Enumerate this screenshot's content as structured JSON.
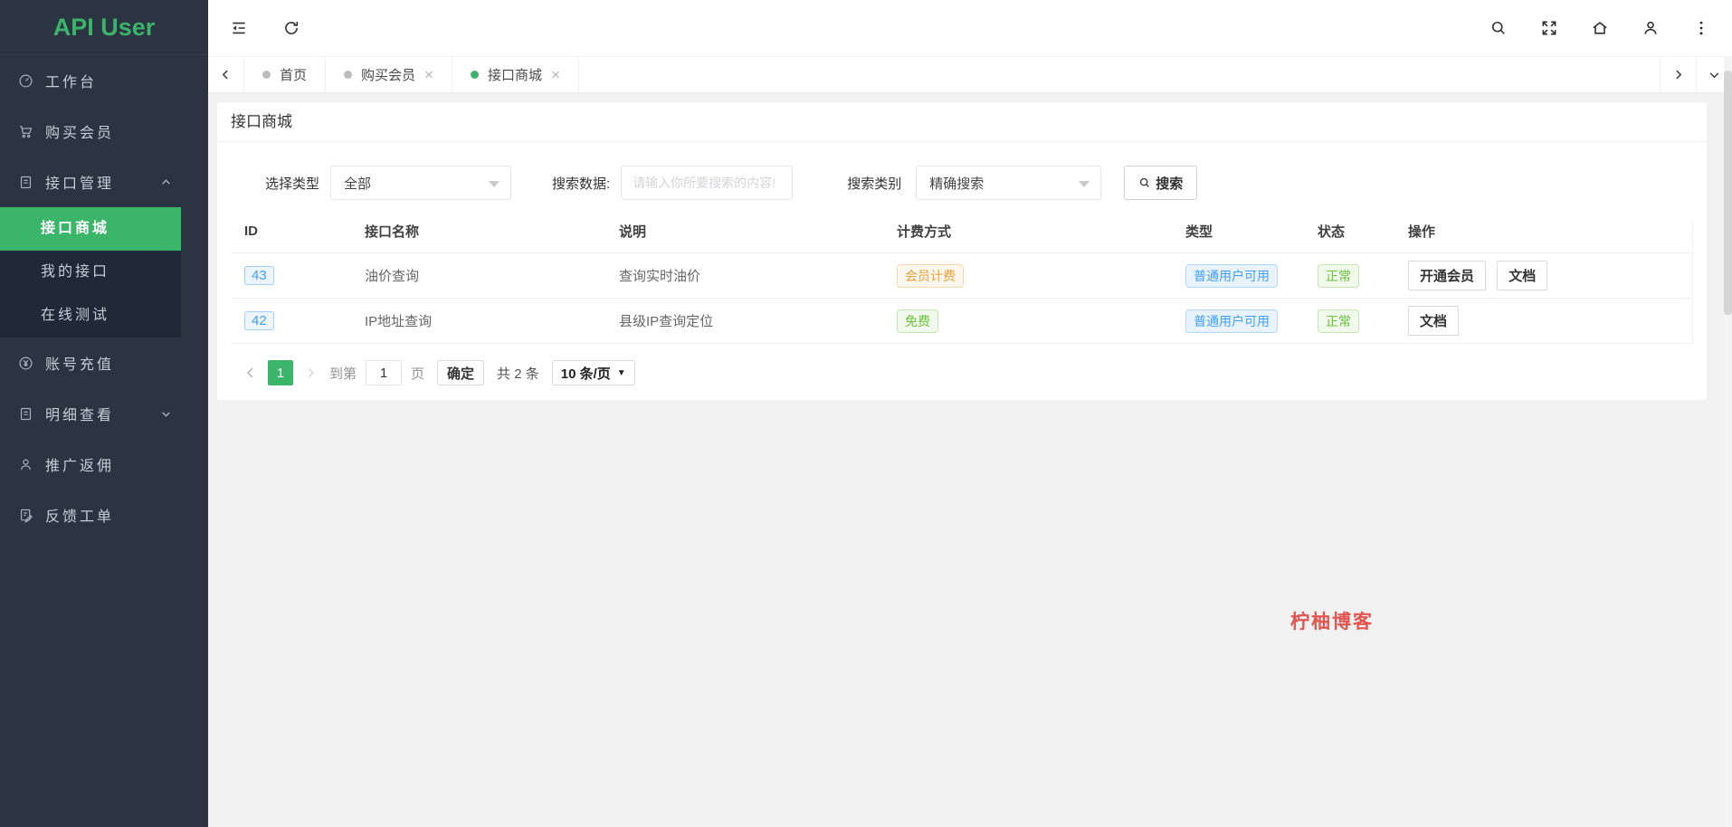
{
  "app_title": "API User",
  "colors": {
    "brand_green": "#3ab56a",
    "sidebar_bg": "#2b3441",
    "submenu_bg": "#1f2937",
    "badge_blue": "#409eff",
    "badge_orange": "#e6a23c",
    "badge_green": "#67c23a",
    "watermark_red": "#e25450"
  },
  "sidebar": {
    "items": [
      {
        "label": "工作台",
        "icon": "dashboard-icon"
      },
      {
        "label": "购买会员",
        "icon": "cart-icon"
      },
      {
        "label": "接口管理",
        "icon": "file-icon",
        "expanded": true,
        "children": [
          {
            "label": "接口商城",
            "active": true
          },
          {
            "label": "我的接口"
          },
          {
            "label": "在线测试"
          }
        ]
      },
      {
        "label": "账号充值",
        "icon": "yen-icon"
      },
      {
        "label": "明细查看",
        "icon": "file-icon",
        "expanded": false
      },
      {
        "label": "推广返佣",
        "icon": "user-icon"
      },
      {
        "label": "反馈工单",
        "icon": "ticket-icon"
      }
    ]
  },
  "topbar": {
    "left_icons": [
      "collapse-icon",
      "refresh-icon"
    ],
    "right_icons": [
      "search-icon",
      "fullscreen-icon",
      "home-icon",
      "user-icon",
      "more-icon"
    ]
  },
  "tabbar": {
    "tabs": [
      {
        "label": "首页",
        "closable": false,
        "active": false
      },
      {
        "label": "购买会员",
        "closable": true,
        "active": false
      },
      {
        "label": "接口商城",
        "closable": true,
        "active": true
      }
    ],
    "close_glyph": "×"
  },
  "page": {
    "title": "接口商城",
    "filter": {
      "type_label": "选择类型",
      "type_value": "全部",
      "search_label": "搜索数据:",
      "search_placeholder": "请输入你所要搜索的内容!",
      "category_label": "搜索类别",
      "category_value": "精确搜索",
      "search_button": "搜索"
    },
    "table": {
      "columns": [
        "ID",
        "接口名称",
        "说明",
        "计费方式",
        "类型",
        "状态",
        "操作"
      ],
      "rows": [
        {
          "id": "43",
          "name": "油价查询",
          "desc": "查询实时油价",
          "billing": "会员计费",
          "type": "普通用户可用",
          "status": "正常",
          "actions": [
            "开通会员",
            "文档"
          ]
        },
        {
          "id": "42",
          "name": "IP地址查询",
          "desc": "县级IP查询定位",
          "billing": "免费",
          "type": "普通用户可用",
          "status": "正常",
          "actions": [
            "文档"
          ]
        }
      ]
    },
    "pagination": {
      "current_page": "1",
      "goto_label": "到第",
      "goto_value": "1",
      "page_unit": "页",
      "confirm_label": "确定",
      "total_label": "共 2 条",
      "page_size": "10 条/页"
    }
  },
  "watermark": "柠柚博客"
}
